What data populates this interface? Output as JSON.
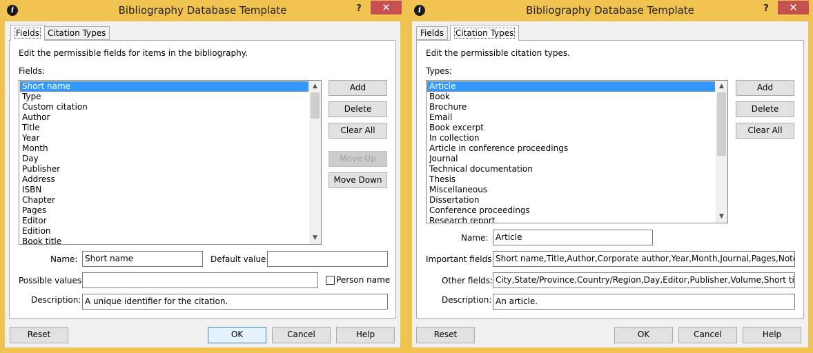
{
  "left": {
    "title": "Bibliography Database Template",
    "help": "?",
    "close": "✕",
    "tabs": [
      {
        "label": "Fields"
      },
      {
        "label": "Citation Types"
      }
    ],
    "description_text": "Edit the permissible fields for items in the bibliography.",
    "list_label": "Fields:",
    "items": [
      "Short name",
      "Type",
      "Custom citation",
      "Author",
      "Title",
      "Year",
      "Month",
      "Day",
      "Publisher",
      "Address",
      "ISBN",
      "Chapter",
      "Pages",
      "Editor",
      "Edition",
      "Book title"
    ],
    "buttons": {
      "add": "Add",
      "delete": "Delete",
      "clear_all": "Clear All",
      "move_up": "Move Up",
      "move_down": "Move Down"
    },
    "name_label": "Name:",
    "name_value": "Short name",
    "default_label": "Default value:",
    "default_value": "",
    "possible_label": "Possible values:",
    "possible_value": "",
    "person_name_label": "Person name",
    "desc_label": "Description:",
    "desc_value": "A unique identifier for the citation.",
    "footer": {
      "reset": "Reset",
      "ok": "OK",
      "cancel": "Cancel",
      "help": "Help"
    }
  },
  "right": {
    "title": "Bibliography Database Template",
    "help": "?",
    "close": "✕",
    "tabs": [
      {
        "label": "Fields"
      },
      {
        "label": "Citation Types"
      }
    ],
    "description_text": "Edit the permissible citation types.",
    "list_label": "Types:",
    "items": [
      "Article",
      "Book",
      "Brochure",
      "Email",
      "Book excerpt",
      "In collection",
      "Article in conference proceedings",
      "Journal",
      "Technical documentation",
      "Thesis",
      "Miscellaneous",
      "Dissertation",
      "Conference proceedings",
      "Research report"
    ],
    "buttons": {
      "add": "Add",
      "delete": "Delete",
      "clear_all": "Clear All"
    },
    "name_label": "Name:",
    "name_value": "Article",
    "important_label": "Important fields:",
    "important_value": "Short name,Title,Author,Corporate author,Year,Month,Journal,Pages,Note",
    "other_label": "Other fields:",
    "other_value": "City,State/Province,Country/Region,Day,Editor,Publisher,Volume,Short title,ISBN,E",
    "desc_label": "Description:",
    "desc_value": "An article.",
    "footer": {
      "reset": "Reset",
      "ok": "OK",
      "cancel": "Cancel",
      "help": "Help"
    }
  }
}
